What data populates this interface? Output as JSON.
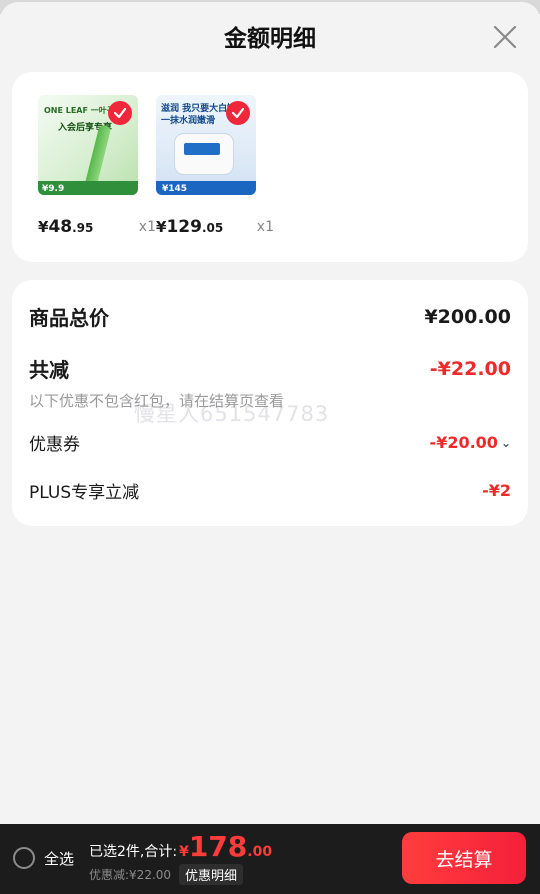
{
  "header": {
    "title": "金额明细"
  },
  "products": [
    {
      "thumb_text_1": "ONE LEAF 一叶子",
      "thumb_text_2": "入会后享专享",
      "thumb_price": "¥9.9",
      "yen": "¥",
      "price_int": "48",
      "price_dec": ".95",
      "qty": "x1"
    },
    {
      "thumb_text_1": "滋润 我只要大白罐",
      "thumb_text_2": "一抹水润嫩滑",
      "thumb_price": "¥145",
      "yen": "¥",
      "price_int": "129",
      "price_dec": ".05",
      "qty": "x1"
    }
  ],
  "details": {
    "total_label": "商品总价",
    "total_value": "¥200.00",
    "reduce_label": "共减",
    "reduce_value": "-¥22.00",
    "note": "以下优惠不包含红包，请在结算页查看",
    "watermark": "慢星人651547783",
    "coupon_label": "优惠券",
    "coupon_value": "-¥20.00",
    "plus_label": "PLUS专享立减",
    "plus_value": "-¥2"
  },
  "bottom_bar": {
    "select_all": "全选",
    "count_text": "已选2件,合计:",
    "yen": "¥",
    "total_int": "178",
    "total_dec": ".00",
    "discount_text": "优惠减:¥22.00",
    "detail_button": "优惠明细",
    "checkout_button": "去结算"
  },
  "colors": {
    "accent_red": "#ee2a2a",
    "bar_bg": "#1c1c1c"
  }
}
